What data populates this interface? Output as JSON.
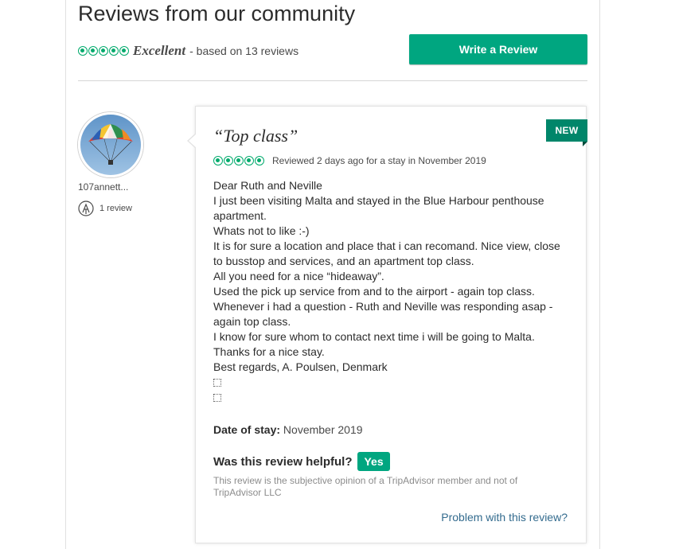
{
  "header": {
    "title": "Reviews from our community",
    "rating_label": "Excellent",
    "based_on": "- based on 13 reviews",
    "write_review_label": "Write a Review",
    "rating_bubbles": 5
  },
  "reviewer": {
    "username": "107annett...",
    "review_count": "1 review",
    "avatar_icon": "parasailing-avatar",
    "contributor_icon": "contributor-badge-icon"
  },
  "review": {
    "badge": "NEW",
    "title": "“Top class”",
    "rating_bubbles": 5,
    "reviewed_meta": "Reviewed 2 days ago for a stay in November 2019",
    "body_lines": [
      "Dear Ruth and Neville",
      "I just been visiting Malta and stayed in the Blue Harbour penthouse",
      "apartment.",
      "Whats not to like :-)",
      "It is for sure a location and place that i can recomand. Nice view, close",
      "to busstop and services, and an apartment top class.",
      "All you need for a nice “hideaway”.",
      "Used the pick up service from and to the airport - again top class.",
      "Whenever i had a question - Ruth and Neville was responding asap -",
      "again top class.",
      "I know for sure whom to contact next time i will be going to Malta.",
      "Thanks for a nice stay.",
      "Best regards, A. Poulsen, Denmark"
    ],
    "date_of_stay_label": "Date of stay:",
    "date_of_stay_value": "November 2019",
    "helpful_question": "Was this review helpful?",
    "yes_label": "Yes",
    "disclaimer": "This review is the subjective opinion of a TripAdvisor member and not of TripAdvisor LLC",
    "problem_link": "Problem with this review?"
  },
  "colors": {
    "accent": "#00a680",
    "bubble": "#00aa6c",
    "badge": "#00866a",
    "link": "#336b8e"
  }
}
